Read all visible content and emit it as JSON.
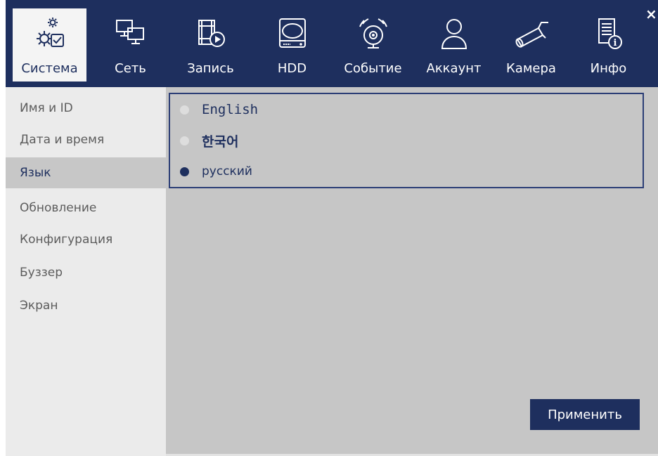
{
  "tabs": [
    {
      "label": "Система",
      "icon": "gear-check-icon",
      "active": true
    },
    {
      "label": "Сеть",
      "icon": "network-icon",
      "active": false
    },
    {
      "label": "Запись",
      "icon": "film-record-icon",
      "active": false
    },
    {
      "label": "HDD",
      "icon": "hdd-icon",
      "active": false
    },
    {
      "label": "Событие",
      "icon": "alarm-bell-icon",
      "active": false
    },
    {
      "label": "Аккаунт",
      "icon": "user-icon",
      "active": false
    },
    {
      "label": "Камера",
      "icon": "camera-icon",
      "active": false
    },
    {
      "label": "Инфо",
      "icon": "info-document-icon",
      "active": false
    }
  ],
  "close_glyph": "×",
  "sidebar": {
    "items": [
      {
        "label": "Имя и ID",
        "active": false
      },
      {
        "label": "Дата и время",
        "active": false
      },
      {
        "label": "Язык",
        "active": true
      },
      {
        "label": "Обновление",
        "active": false
      },
      {
        "label": "Конфигурация",
        "active": false
      },
      {
        "label": "Буззер",
        "active": false
      },
      {
        "label": "Экран",
        "active": false
      }
    ]
  },
  "languages": [
    {
      "label": "English",
      "selected": false
    },
    {
      "label": "한국어",
      "selected": false
    },
    {
      "label": "русский",
      "selected": true
    }
  ],
  "apply_label": "Применить",
  "colors": {
    "navy": "#1e2f5e",
    "panel_gray": "#c6c6c6",
    "sidebar_gray": "#ebebeb",
    "active_sidebar": "#c7c7c7"
  }
}
